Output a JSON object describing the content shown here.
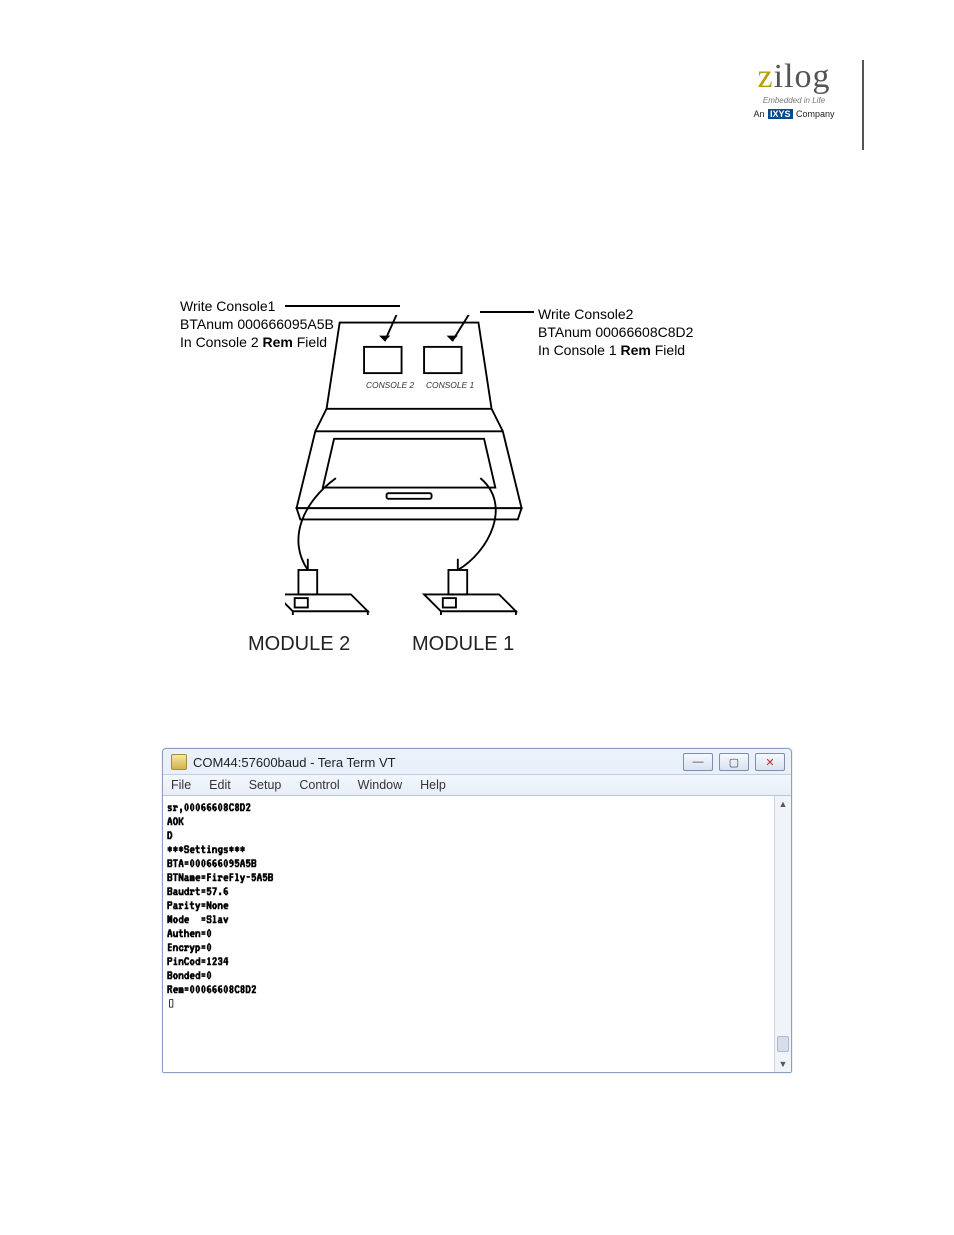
{
  "logo": {
    "word_first": "z",
    "word_rest": "ilog",
    "sub1": "Embedded in Life",
    "sub2_pre": "An ",
    "sub2_ixys": "IXYS",
    "sub2_post": " Company"
  },
  "diagram": {
    "left_label_l1": "Write Console1",
    "left_label_l2": "BTAnum 000666095A5B",
    "left_label_l3_pre": "In Console 2 ",
    "left_label_l3_bold": "Rem",
    "left_label_l3_post": " Field",
    "right_label_l1": "Write Console2",
    "right_label_l2": "BTAnum 00066608C8D2",
    "right_label_l3_pre": "In Console 1 ",
    "right_label_l3_bold": "Rem",
    "right_label_l3_post": " Field",
    "console1": "CONSOLE 1",
    "console2": "CONSOLE 2",
    "module1": "MODULE 1",
    "module2": "MODULE 2"
  },
  "terminal": {
    "title": "COM44:57600baud - Tera Term VT",
    "menu": [
      "File",
      "Edit",
      "Setup",
      "Control",
      "Window",
      "Help"
    ],
    "output": "sr,00066608C8D2\nAOK\nD\n***Settings***\nBTA=000666095A5B\nBTName=FireFly-5A5B\nBaudrt=57.6\nParity=None\nMode  =Slav\nAuthen=0\nEncryp=0\nPinCod=1234\nBonded=0\nRem=00066608C8D2\n▯"
  }
}
